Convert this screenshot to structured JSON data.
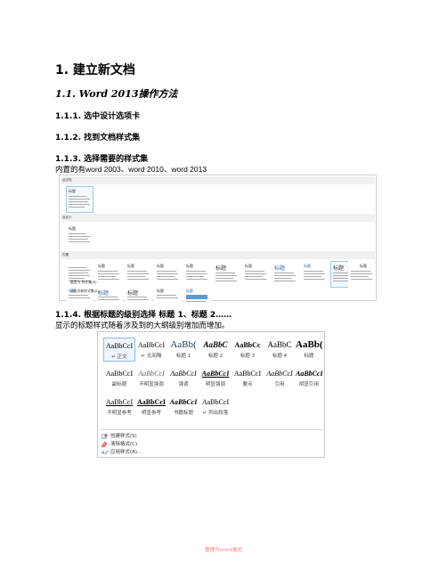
{
  "heading1": "1.  建立新文档",
  "heading2": "1.1.  Word 2013操作方法",
  "step1": "1.1.1.  选中设计选项卡",
  "step2": "1.1.2.  找到文档样式集",
  "step3": "1.1.3.  选择需要的样式集",
  "step3_text": "内置的有word 2003、word 2010、word 2013",
  "step4": "1.1.4.  根据标题的级别选择  标题 1、标题 2……",
  "step4_text": "显示的标题样式随着涉及到的大纲级别增加而增加。",
  "gallery1": {
    "section_this": "此文档",
    "section_custom": "自定义",
    "section_builtin": "内置",
    "row1_titles": [
      "",
      "标题",
      "标题",
      "标题",
      "标题",
      "标题",
      "标题",
      "标题",
      "标题",
      "标题",
      "标题"
    ],
    "row2_titles": [
      "标题",
      "标题",
      "标题",
      "标题",
      "标题"
    ],
    "menu_reset": "重置为 样式集(R)",
    "menu_save": "另存为新样式集(S)..."
  },
  "gallery2": {
    "row1": [
      {
        "sample": "AaBbCcI",
        "name": "↵ 正文"
      },
      {
        "sample": "AaBbCcI",
        "name": "↵ 无间隔"
      },
      {
        "sample": "AaBb(",
        "name": "标题 1"
      },
      {
        "sample": "AaBbC",
        "name": "标题 2"
      },
      {
        "sample": "AaBbCc",
        "name": "标题 3"
      },
      {
        "sample": "AaBbC",
        "name": "标题 4"
      },
      {
        "sample": "AaBb(",
        "name": "标题"
      }
    ],
    "row2": [
      {
        "sample": "AaBbCcI",
        "name": "副标题"
      },
      {
        "sample": "AaBbCcI",
        "name": "不明显强调"
      },
      {
        "sample": "AaBbCcI",
        "name": "强调"
      },
      {
        "sample": "AaBbCcI",
        "name": "明显强调"
      },
      {
        "sample": "AaBbCcI",
        "name": "要点"
      },
      {
        "sample": "AaBbCcI",
        "name": "引用"
      },
      {
        "sample": "AaBbCcI",
        "name": "明显引用"
      }
    ],
    "row3": [
      {
        "sample": "AaBbCcI",
        "name": "不明显参考"
      },
      {
        "sample": "AaBbCcI",
        "name": "明显参考"
      },
      {
        "sample": "AaBbCcI",
        "name": "书籍标题"
      },
      {
        "sample": "AaBbCcI",
        "name": "↵ 列出段落"
      }
    ],
    "menu": [
      "创建样式(S)",
      "清除格式(C)",
      "应用样式(A)..."
    ]
  },
  "footer": "整理为word格式",
  "colors": {
    "accent": "#2e74b5",
    "selection": "#8fb8e0",
    "footer": "#f08080"
  }
}
